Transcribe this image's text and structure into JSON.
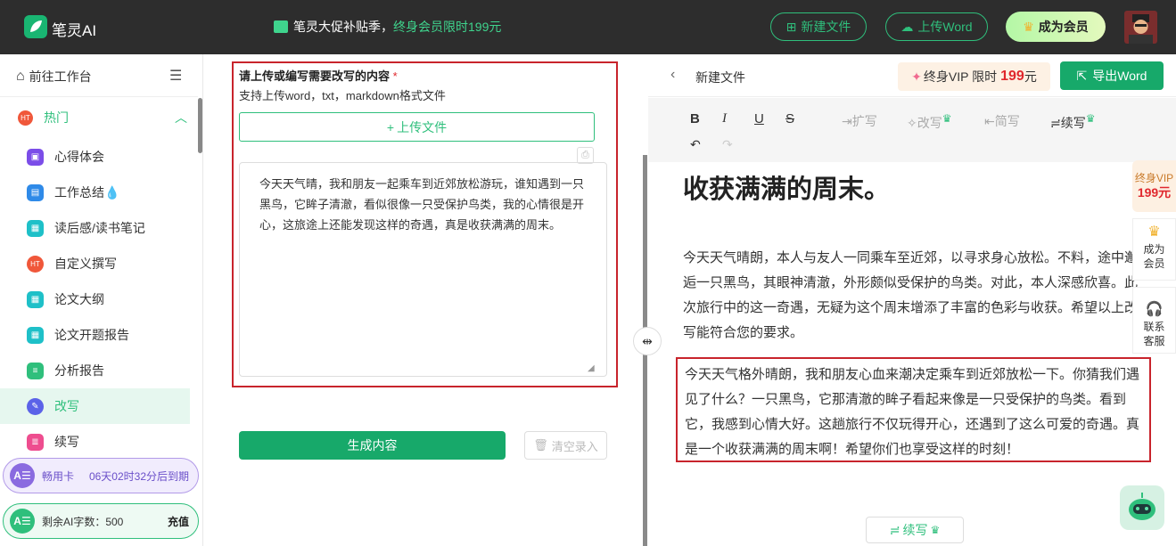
{
  "header": {
    "logo_text": "笔灵AI",
    "promo_main": "笔灵大促补贴季，",
    "promo_highlight": "终身会员限时199元",
    "new_file": "新建文件",
    "upload_word": "上传Word",
    "become_member": "成为会员"
  },
  "sidebar": {
    "workbench": "前往工作台",
    "hot": "热门",
    "items": [
      {
        "label": "心得体会",
        "color": "#7b4de8"
      },
      {
        "label": "工作总结💧",
        "color": "#2f8ae8"
      },
      {
        "label": "读后感/读书笔记",
        "color": "#1ec0c8"
      },
      {
        "label": "自定义撰写",
        "color": "#f0573a"
      },
      {
        "label": "论文大纲",
        "color": "#1ec0c8"
      },
      {
        "label": "论文开题报告",
        "color": "#1ec0c8"
      },
      {
        "label": "分析报告",
        "color": "#2fbf7c"
      },
      {
        "label": "改写",
        "color": "#5b62e8"
      },
      {
        "label": "续写",
        "color": "#ee4d8f"
      }
    ],
    "card1_name": "畅用卡",
    "card1_info": "06天02时32分后到期",
    "card2_label": "剩余AI字数：500",
    "card2_action": "充值"
  },
  "editor": {
    "label": "请上传或编写需要改写的内容",
    "required_mark": "*",
    "hint": "支持上传word，txt，markdown格式文件",
    "upload_button": "上传文件",
    "content": "今天天气晴，我和朋友一起乘车到近郊放松游玩，谁知遇到一只黑鸟，它眸子清澈，看似很像一只受保护鸟类，我的心情很是开心，这旅途上还能发现这样的奇遇，真是收获满满的周末。",
    "generate": "生成内容",
    "clear": "清空录入"
  },
  "result": {
    "back_title": "新建文件",
    "vip_pill": "终身VIP 限时",
    "vip_price": "199",
    "vip_unit": "元",
    "export": "导出Word",
    "tools": {
      "expand": "扩写",
      "rewrite": "改写",
      "simplify": "简写",
      "continue": "续写"
    },
    "title": "收获满满的周末。",
    "para1": "今天天气晴朗，本人与友人一同乘车至近郊，以寻求身心放松。不料，途中邂逅一只黑鸟，其眼神清澈，外形颇似受保护的鸟类。对此，本人深感欣喜。此次旅行中的这一奇遇，无疑为这个周末增添了丰富的色彩与收获。希望以上改写能符合您的要求。",
    "para2": "今天天气格外晴朗，我和朋友心血来潮决定乘车到近郊放松一下。你猜我们遇见了什么？一只黑鸟，它那清澈的眸子看起来像是一只受保护的鸟类。看到它，我感到心情大好。这趟旅行不仅玩得开心，还遇到了这么可爱的奇遇。真是一个收获满满的周末啊！希望你们也享受这样的时刻！",
    "continue_button": "续写"
  },
  "float": {
    "vip_label": "终身VIP",
    "vip_price": "199元",
    "member": "成为会员",
    "contact": "联系客服"
  },
  "colors": {
    "brand_green": "#17a96a",
    "highlight_red": "#c8242c",
    "vip_red": "#e0272d"
  }
}
